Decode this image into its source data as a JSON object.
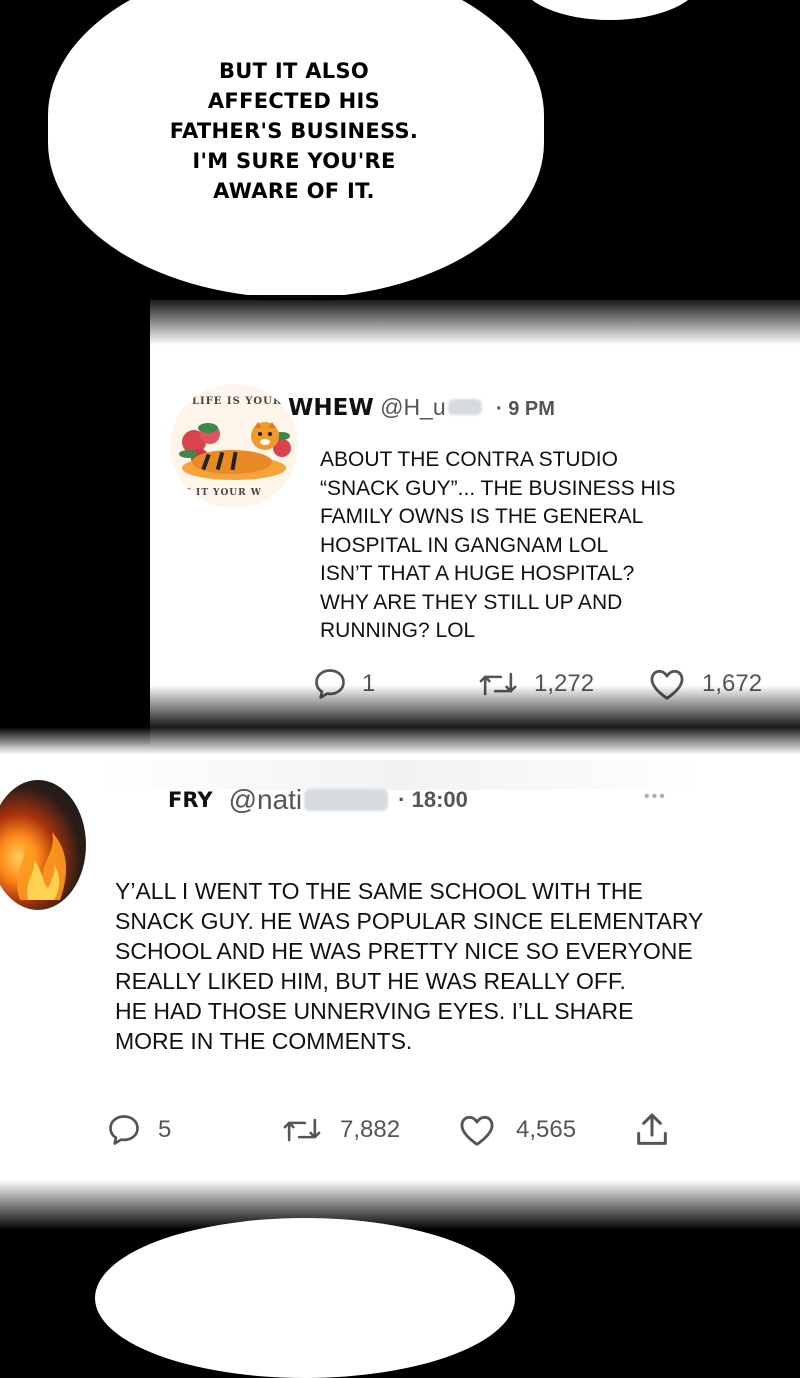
{
  "bubble": {
    "lines": [
      "BUT IT ALSO",
      "AFFECTED HIS",
      "FATHER'S BUSINESS.",
      "I'M SURE YOU'RE",
      "AWARE OF IT."
    ]
  },
  "tweet1": {
    "avatar_text_top": "LIFE IS YOURS",
    "avatar_text_bottom": "E IT YOUR W",
    "name": "WHEW",
    "handle": "@H_u",
    "time": "· 9 PM",
    "body": [
      "ABOUT THE CONTRA STUDIO",
      "“SNACK GUY”... THE BUSINESS HIS",
      "FAMILY OWNS IS THE GENERAL",
      "HOSPITAL IN GANGNAM LOL",
      "ISN’T THAT A HUGE HOSPITAL?",
      "WHY ARE THEY STILL UP AND",
      "RUNNING? LOL"
    ],
    "replies": "1",
    "retweets": "1,272",
    "likes": "1,672"
  },
  "tweet2": {
    "name": "FRY",
    "handle": "@nati",
    "time": "· 18:00",
    "more": "•••",
    "body": [
      "Y’ALL I WENT TO THE SAME SCHOOL WITH THE",
      "SNACK GUY. HE WAS POPULAR SINCE ELEMENTARY",
      "SCHOOL AND HE WAS PRETTY NICE SO EVERYONE",
      "REALLY LIKED HIM, BUT HE WAS REALLY OFF.",
      "HE HAD THOSE UNNERVING EYES. I’LL SHARE",
      "MORE IN THE COMMENTS."
    ],
    "replies": "5",
    "retweets": "7,882",
    "likes": "4,565"
  },
  "colors": {
    "accent_gray": "#555555",
    "panel": "#ffffff",
    "background": "#000000"
  }
}
